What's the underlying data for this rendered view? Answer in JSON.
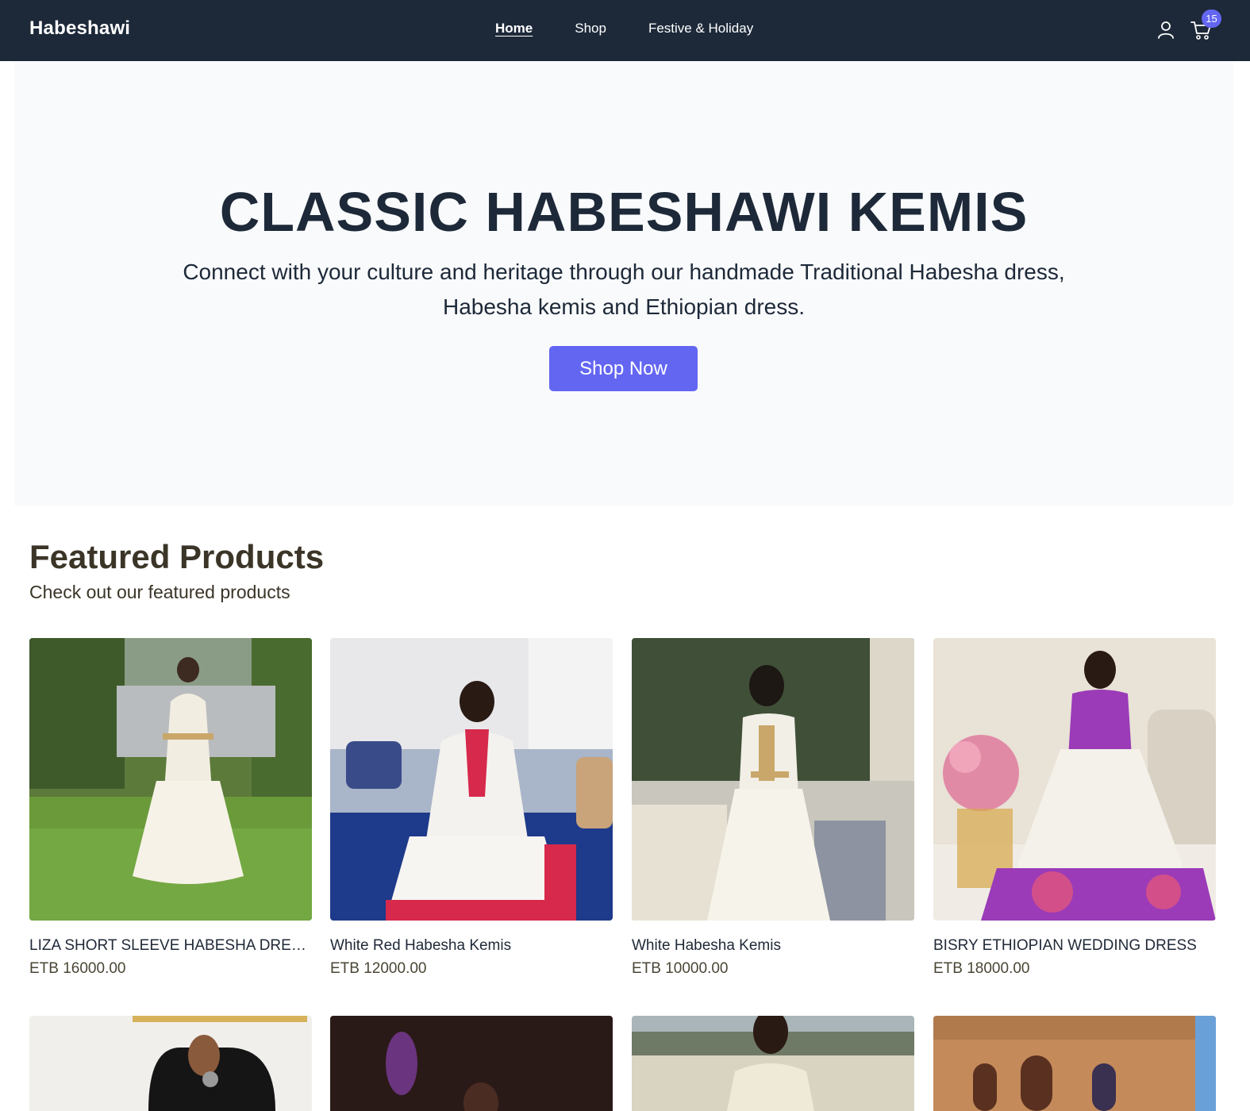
{
  "header": {
    "brand": "Habeshawi",
    "nav": [
      {
        "label": "Home",
        "active": true
      },
      {
        "label": "Shop",
        "active": false
      },
      {
        "label": "Festive & Holiday",
        "active": false
      }
    ],
    "icons": [
      "user-icon",
      "cart-icon"
    ],
    "cart_count": "15",
    "background": "#1d2939",
    "accent": "#6366f1"
  },
  "hero": {
    "title": "CLASSIC HABESHAWI KEMIS",
    "subtitle": "Connect with your culture and heritage through our handmade Traditional Habesha dress, Habesha kemis and Ethiopian dress.",
    "cta": "Shop Now"
  },
  "featured": {
    "title": "Featured Products",
    "subtitle": "Check out our featured products",
    "products": [
      {
        "name": "LIZA SHORT SLEEVE HABESHA DRESS",
        "price": "ETB 16000.00"
      },
      {
        "name": "White Red Habesha Kemis",
        "price": "ETB 12000.00"
      },
      {
        "name": "White Habesha Kemis",
        "price": "ETB 10000.00"
      },
      {
        "name": "BISRY ETHIOPIAN WEDDING DRESS",
        "price": "ETB 18000.00"
      }
    ]
  }
}
